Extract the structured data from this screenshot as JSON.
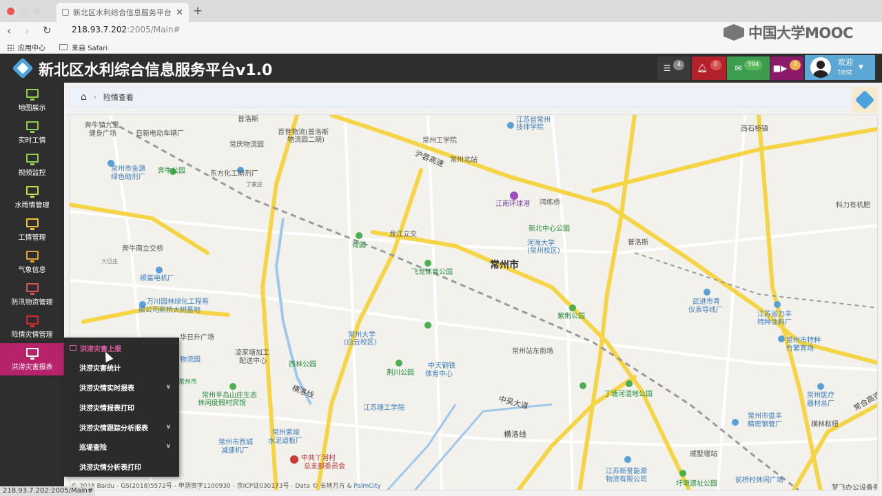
{
  "browser": {
    "tab_title": "新北区水利综合信息服务平台",
    "url_host": "218.93.7.202",
    "url_path": ":2005/Main#",
    "bookmarks": [
      "应用中心",
      "来自 Safari"
    ],
    "status_url": "218.93.7.202:2005/Main#"
  },
  "watermark": {
    "text": "中国大学MOOC"
  },
  "header": {
    "title": "新北区水利综合信息服务平台v1.0",
    "buttons": [
      {
        "icon": "list-icon",
        "count": "4",
        "color": "#3a3a3a",
        "badge_color": "#888888"
      },
      {
        "icon": "bell-icon",
        "count": "0",
        "color": "#b3222b",
        "badge_color": "#d9534f"
      },
      {
        "icon": "envelope-icon",
        "count": "394",
        "color": "#3d9d4f",
        "badge_color": "#5cb85c"
      },
      {
        "icon": "video-icon",
        "count": "0",
        "color": "#8c1a6b",
        "badge_color": "#f0ad4e"
      }
    ],
    "user": {
      "greeting": "欢迎",
      "name": "test"
    }
  },
  "sidebar": {
    "items": [
      {
        "label": "地图展示",
        "icon_color": "#8fd14f",
        "name": "map"
      },
      {
        "label": "实时工情",
        "icon_color": "#8fd14f",
        "name": "realtime"
      },
      {
        "label": "视频监控",
        "icon_color": "#8fd14f",
        "name": "video"
      },
      {
        "label": "水雨情管理",
        "icon_color": "#c6d94a",
        "name": "rain"
      },
      {
        "label": "工情管理",
        "icon_color": "#e8c23a",
        "name": "works"
      },
      {
        "label": "气象信息",
        "icon_color": "#e8a23a",
        "name": "weather"
      },
      {
        "label": "防汛物资管理",
        "icon_color": "#d9534f",
        "name": "supplies"
      },
      {
        "label": "险情灾情管理",
        "icon_color": "#d9292f",
        "name": "danger"
      },
      {
        "label": "洪涝灾害报表",
        "icon_color": "#ffffff",
        "name": "flood-report"
      }
    ]
  },
  "breadcrumb": {
    "current": "险情查看"
  },
  "flyout": {
    "items": [
      {
        "label": "洪涝灾害上报",
        "has_sub": false
      },
      {
        "label": "洪涝灾害统计",
        "has_sub": false
      },
      {
        "label": "洪涝灾情实时报表",
        "has_sub": true
      },
      {
        "label": "洪涝灾情报表打印",
        "has_sub": false
      },
      {
        "label": "洪涝灾情跟踪分析报表",
        "has_sub": true
      },
      {
        "label": "巡堤查险",
        "has_sub": true
      },
      {
        "label": "洪涝灾情分析表打印",
        "has_sub": false
      }
    ]
  },
  "map": {
    "city_label": "常州市",
    "labels": [
      "普洛斯",
      "奔牛镇九里",
      "健身广场",
      "日新电动车辆厂",
      "百世物流(普洛斯",
      "物流园二期)",
      "常庆物流园",
      "常州工学院",
      "江苏省常州",
      "技师学院",
      "常州北站",
      "西石桥镇",
      "沪蓉高速",
      "常州市金源",
      "绿色助剂厂",
      "奔牛公园",
      "东方化工助剂厂",
      "丁家庄",
      "江南环球港",
      "鸿练桥",
      "科力有机肥",
      "新北中心公园",
      "河海大学",
      "(常州校区)",
      "普洛斯",
      "龙江立交",
      "荷园",
      "奔牛南立交桥",
      "大垣庄",
      "常州市",
      "飞龙体育公园",
      "顺富电机厂",
      "万川园林绿化工程有",
      "限公司新桥大树基地",
      "武进市青",
      "仪表导线厂",
      "江苏省力丰",
      "特种涂料厂",
      "紫荆公园",
      "华日升广场",
      "常州大学",
      "(白云校区)",
      "凌家塘加工",
      "配送中心",
      "常州站东街场",
      "常州市特种",
      "竹繁育场",
      "物流园",
      "西林公园",
      "荆川公园",
      "中天钢铁",
      "体育中心",
      "丁塘河湿地公园",
      "横洛线",
      "常州市",
      "常州半岛山庄生态",
      "休闲度假村宾馆",
      "江苏理工学院",
      "中吴大道",
      "常州医疗",
      "器材总厂",
      "常州紫竣",
      "水泥道板厂",
      "常州市俊丰",
      "精密钢管厂",
      "常州市西城",
      "减速机厂",
      "横洛线",
      "横林枢纽",
      "中共丫河村",
      "总支部委员会",
      "戚墅堰站",
      "江苏新誉能源",
      "物流有限公司",
      "前桥村休闲广场",
      "圩墩遗址公园",
      "常合高速",
      "梦飞办公设备有"
    ],
    "credit": "© 2018 Baidu - GS(2018)5572号 - 甲测资字1100930 - 京ICP证030173号 - Data © 长地万方 &",
    "credit_link": "PalmCity"
  }
}
